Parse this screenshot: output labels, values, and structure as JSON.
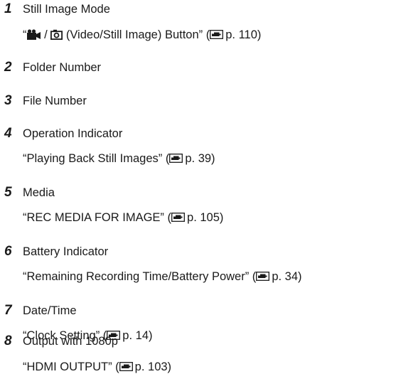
{
  "items": [
    {
      "number": "1",
      "title": "Still Image Mode",
      "ref_open_quote": "“",
      "ref_sep": " / ",
      "ref_text": " (Video/Still Image) Button”",
      "ref_page_open": " (",
      "ref_page": "p. 110",
      "ref_page_close": ")",
      "icons": [
        "video-camera-icon",
        "still-camera-icon",
        "page-reference-icon"
      ]
    },
    {
      "number": "2",
      "title": "Folder Number"
    },
    {
      "number": "3",
      "title": "File Number"
    },
    {
      "number": "4",
      "title": "Operation Indicator",
      "ref_text": "“Playing Back Still Images”",
      "ref_page_open": " (",
      "ref_page": "p. 39",
      "ref_page_close": ")",
      "icons": [
        "page-reference-icon"
      ]
    },
    {
      "number": "5",
      "title": "Media",
      "ref_text": "“REC MEDIA FOR IMAGE”",
      "ref_page_open": " (",
      "ref_page": "p. 105",
      "ref_page_close": ")",
      "icons": [
        "page-reference-icon"
      ]
    },
    {
      "number": "6",
      "title": "Battery Indicator",
      "ref_text": "“Remaining Recording Time/Battery Power”",
      "ref_page_open": " (",
      "ref_page": "p. 34",
      "ref_page_close": ")",
      "icons": [
        "page-reference-icon"
      ]
    },
    {
      "number": "7",
      "title": "Date/Time",
      "ref_text": "“Clock Setting”",
      "ref_page_open": " (",
      "ref_page": "p. 14",
      "ref_page_close": ")",
      "icons": [
        "page-reference-icon"
      ]
    },
    {
      "number": "8",
      "title": "Output with 1080p",
      "ref_text": "“HDMI OUTPUT”",
      "ref_page_open": " (",
      "ref_page": "p. 103",
      "ref_page_close": ")",
      "icons": [
        "page-reference-icon"
      ]
    }
  ]
}
